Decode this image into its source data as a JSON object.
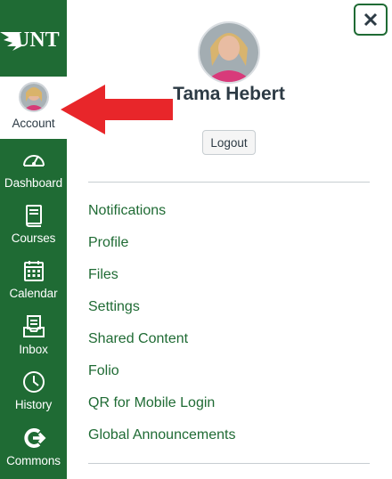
{
  "brand": {
    "logo_text": "UNT",
    "nav_bg": "#1f6b34",
    "link_color": "#1f6b34",
    "arrow_color": "#e8262a"
  },
  "global_nav": {
    "items": [
      {
        "label": "Account",
        "icon": "user-avatar"
      },
      {
        "label": "Dashboard",
        "icon": "speedometer-icon"
      },
      {
        "label": "Courses",
        "icon": "book-icon"
      },
      {
        "label": "Calendar",
        "icon": "calendar-icon"
      },
      {
        "label": "Inbox",
        "icon": "inbox-icon"
      },
      {
        "label": "History",
        "icon": "clock-icon"
      },
      {
        "label": "Commons",
        "icon": "commons-arrow-icon"
      }
    ]
  },
  "tray": {
    "close_label": "×",
    "user_name": "Tama Hebert",
    "logout_label": "Logout",
    "links": [
      "Notifications",
      "Profile",
      "Files",
      "Settings",
      "Shared Content",
      "Folio",
      "QR for Mobile Login",
      "Global Announcements"
    ]
  }
}
